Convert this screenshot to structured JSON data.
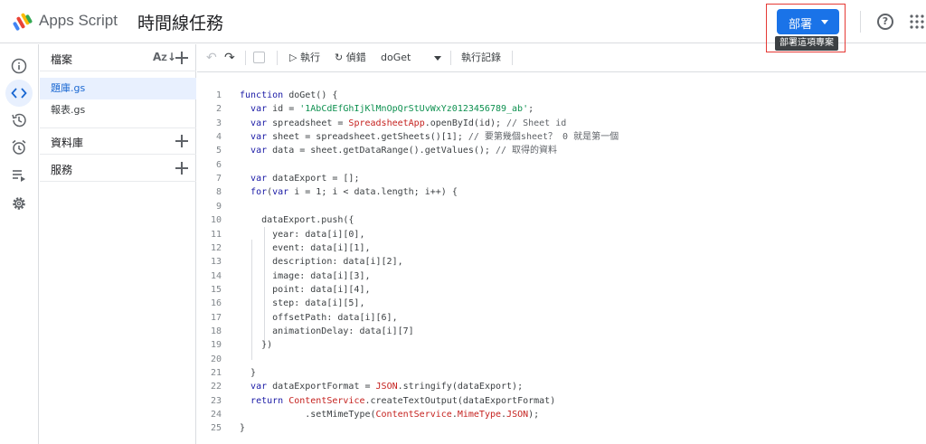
{
  "header": {
    "app_name": "Apps Script",
    "project_title": "時間線任務",
    "deploy_label": "部署",
    "deploy_tooltip": "部署這項專案"
  },
  "rail": {
    "icons": [
      "info-icon",
      "code-icon",
      "history-icon",
      "alarm-icon",
      "executions-icon",
      "settings-icon"
    ],
    "active": "code-icon"
  },
  "files_panel": {
    "files_header": "檔案",
    "files": [
      {
        "name": "題庫.gs",
        "active": true
      },
      {
        "name": "報表.gs",
        "active": false
      }
    ],
    "libraries_header": "資料庫",
    "services_header": "服務"
  },
  "toolbar": {
    "run_label": "執行",
    "debug_label": "偵錯",
    "function_name": "doGet",
    "log_label": "執行記錄"
  },
  "code_lines": [
    "function doGet() {",
    "  var id = '1AbCdEfGhIjKlMnOpQrStUvWxYz0123456789_ab';",
    "  var spreadsheet = SpreadsheetApp.openById(id); // Sheet id",
    "  var sheet = spreadsheet.getSheets()[1]; // 要第幾個sheet？ 0 就是第一個",
    "  var data = sheet.getDataRange().getValues(); // 取得的資料",
    "",
    "  var dataExport = [];",
    "  for(var i = 1; i < data.length; i++) {",
    "",
    "    dataExport.push({",
    "      year: data[i][0],",
    "      event: data[i][1],",
    "      description: data[i][2],",
    "      image: data[i][3],",
    "      point: data[i][4],",
    "      step: data[i][5],",
    "      offsetPath: data[i][6],",
    "      animationDelay: data[i][7]",
    "    })",
    "",
    "  }",
    "  var dataExportFormat = JSON.stringify(dataExport);",
    "  return ContentService.createTextOutput(dataExportFormat)",
    "            .setMimeType(ContentService.MimeType.JSON);",
    "}"
  ],
  "colors": {
    "accent": "#1a73e8",
    "highlight_border": "#e53935",
    "active_bg": "#e8f0fe"
  }
}
